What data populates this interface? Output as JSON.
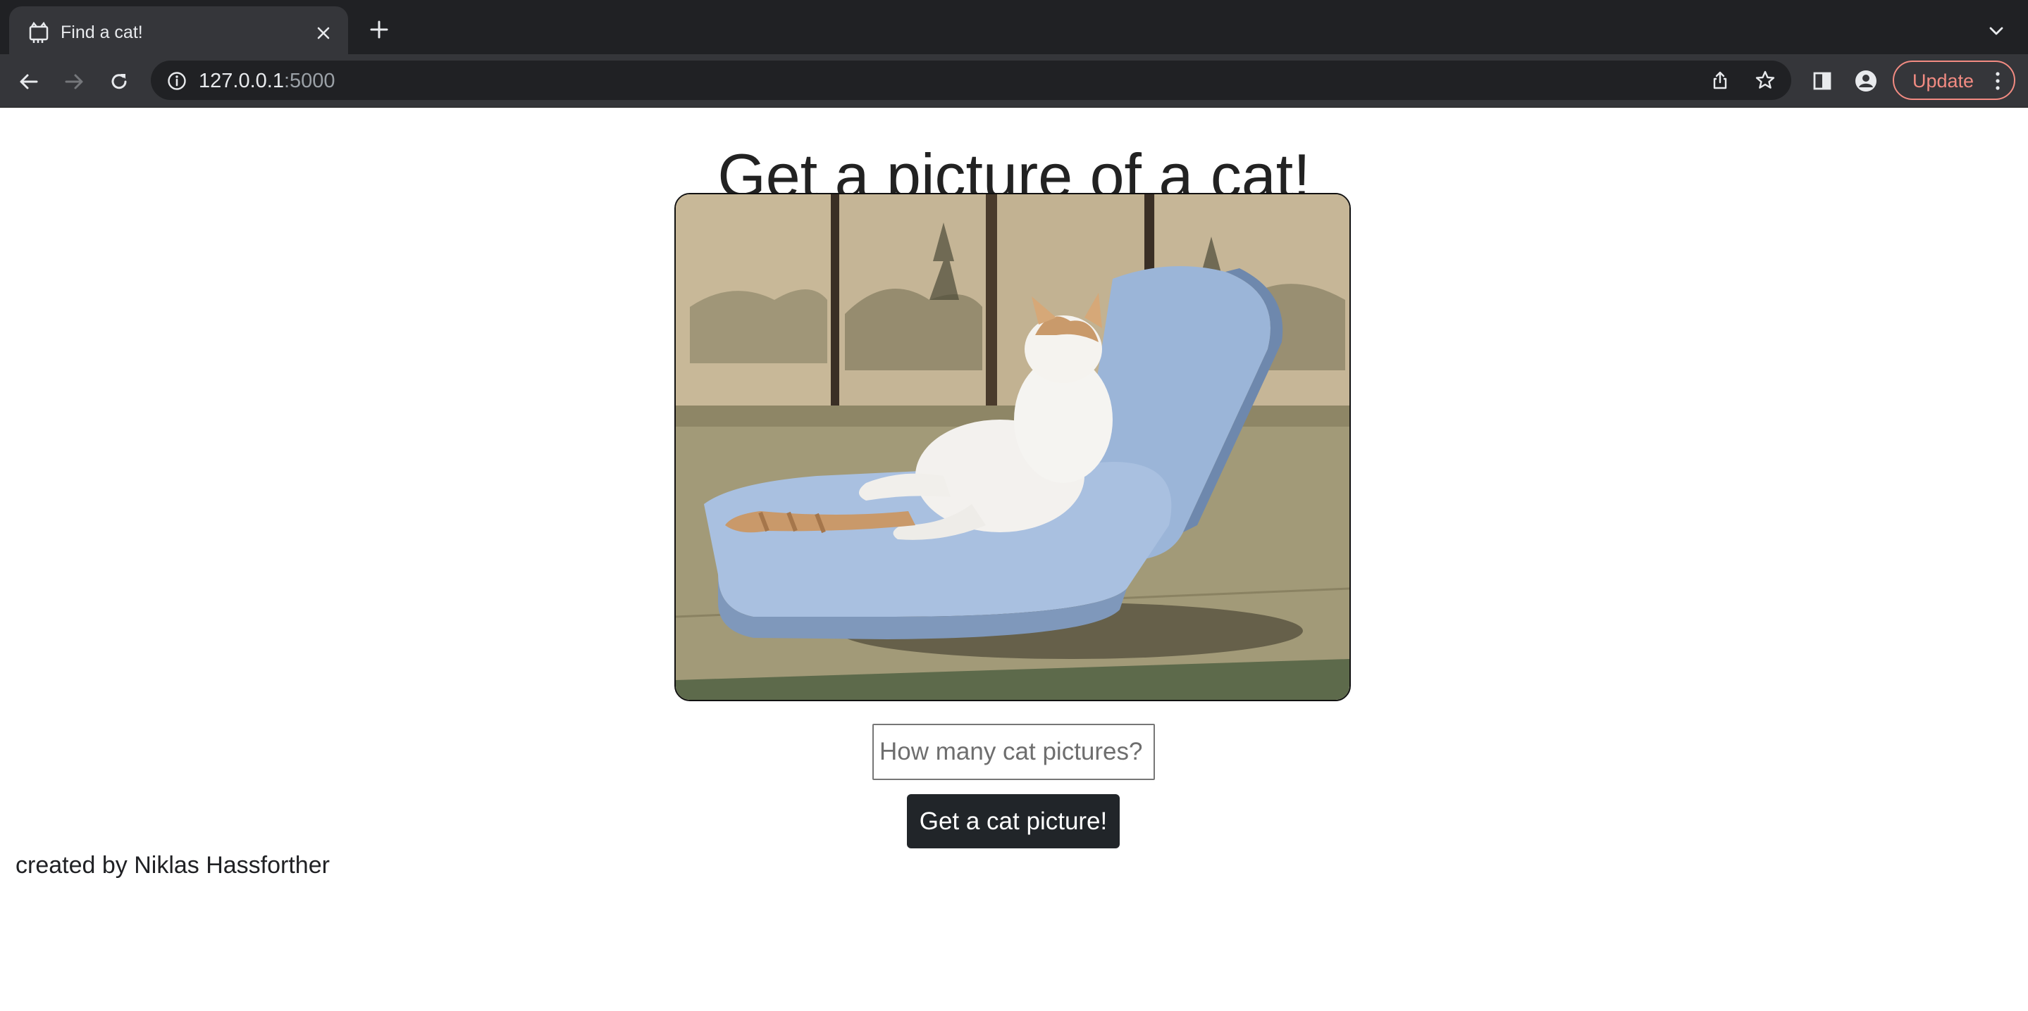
{
  "browser": {
    "tab": {
      "title": "Find a cat!",
      "favicon": "cat-favicon-icon"
    },
    "url_host": "127.0.0.1",
    "url_port": ":5000",
    "update_label": "Update",
    "icons": [
      "back-icon",
      "forward-icon",
      "reload-icon",
      "info-icon",
      "share-icon",
      "star-icon",
      "side-panel-icon",
      "profile-icon",
      "menu-icon",
      "close-icon",
      "plus-icon",
      "chevron-down-icon"
    ]
  },
  "page": {
    "heading": "Get a picture of a cat!",
    "image_alt": "Cat reclining on a light blue floor chair in a tatami room",
    "input_placeholder": "How many cat pictures?",
    "input_value": "",
    "button_label": "Get a cat picture!",
    "footer": "created by Niklas Hassforther"
  },
  "colors": {
    "chrome_dark": "#202124",
    "chrome_toolbar": "#35363a",
    "update_accent": "#f28b82",
    "button_bg": "#212529"
  }
}
